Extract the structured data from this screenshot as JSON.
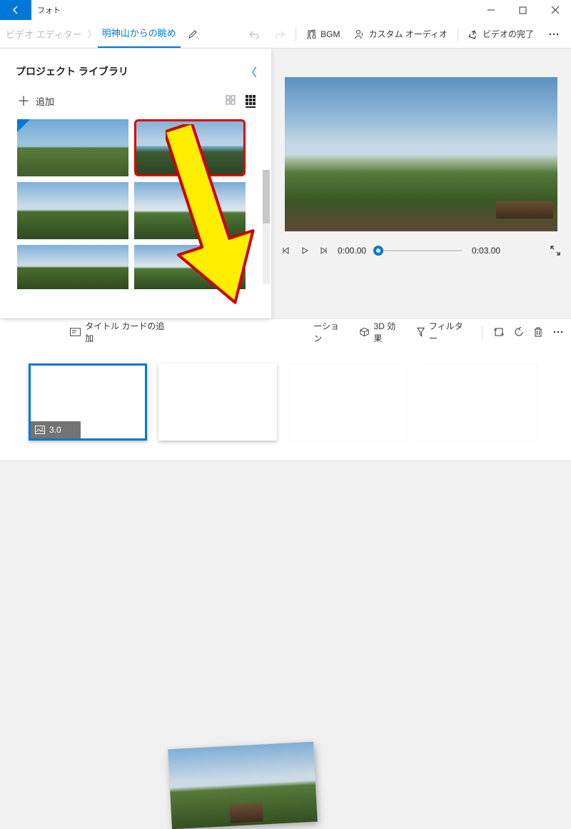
{
  "app_title": "フォト",
  "breadcrumb": {
    "video_editor": "ビデオ エディター",
    "project_title": "明神山からの眺め"
  },
  "toolbar": {
    "bgm": "BGM",
    "custom_audio": "カスタム オーディオ",
    "finish_video": "ビデオの完了"
  },
  "library": {
    "title": "プロジェクト ライブラリ",
    "add_label": "追加"
  },
  "playback": {
    "current": "0:00.00",
    "total": "0:03.00"
  },
  "storyboard_toolbar": {
    "add_title_card": "タイトル カードの追加",
    "motion_suffix": "ーション",
    "effects_3d": "3D 効果",
    "filter": "フィルター"
  },
  "storyboard": {
    "clip_duration": "3.0"
  }
}
